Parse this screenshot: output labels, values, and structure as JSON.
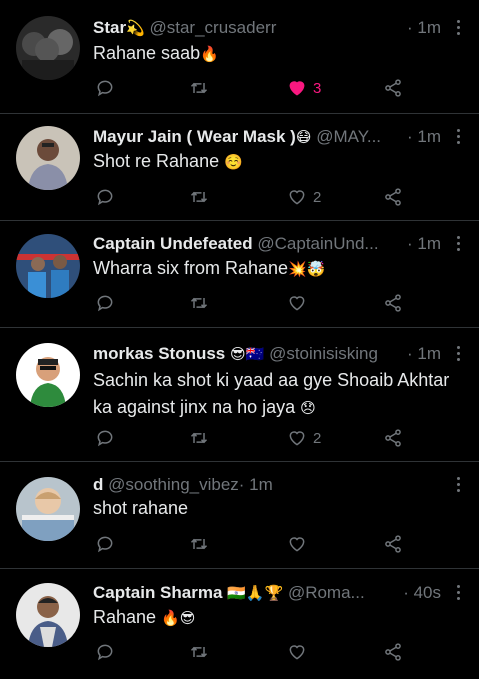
{
  "tweets": [
    {
      "name": "Star",
      "name_emoji": "💫",
      "handle": "@star_crusaderr",
      "time": "· 1m",
      "text": "Rahane saab",
      "text_emoji": "🔥",
      "likes": "3",
      "liked": true
    },
    {
      "name": "Mayur Jain ( Wear Mask )",
      "name_emoji": "😷",
      "handle": "@MAY...",
      "time": "· 1m",
      "text": "Shot re Rahane",
      "text_emoji": "☺️",
      "likes": "2",
      "liked": false
    },
    {
      "name": "Captain Undefeated",
      "name_emoji": "",
      "handle": "@CaptainUnd...",
      "time": "· 1m",
      "text": "Wharra six from Rahane",
      "text_emoji": "💥🤯",
      "likes": "",
      "liked": false
    },
    {
      "name": "morkas Stonuss",
      "name_emoji": "😎🇦🇺",
      "handle": "@stoinisisking",
      "time": "· 1m",
      "text": "Sachin ka shot ki yaad aa gye Shoaib Akhtar ka against jinx na ho jaya",
      "text_emoji": "😞",
      "likes": "2",
      "liked": false
    },
    {
      "name": "d",
      "name_emoji": "",
      "handle": "@soothing_vibez",
      "time": "· 1m",
      "text": "shot rahane",
      "text_emoji": "",
      "likes": "",
      "liked": false
    },
    {
      "name": "Captain Sharma",
      "name_emoji": "🇮🇳🙏🏆",
      "handle": "@Roma...",
      "time": "· 40s",
      "text": "Rahane",
      "text_emoji": "🔥😎",
      "likes": "",
      "liked": false
    }
  ],
  "colors": {
    "background": "#000000",
    "text": "#e7e9ea",
    "muted": "#71767b",
    "like_active": "#f91880",
    "divider": "#2f3336"
  },
  "icons": {
    "reply": "reply-icon",
    "retweet": "retweet-icon",
    "like": "heart-icon",
    "share": "share-icon",
    "more": "more-icon"
  }
}
